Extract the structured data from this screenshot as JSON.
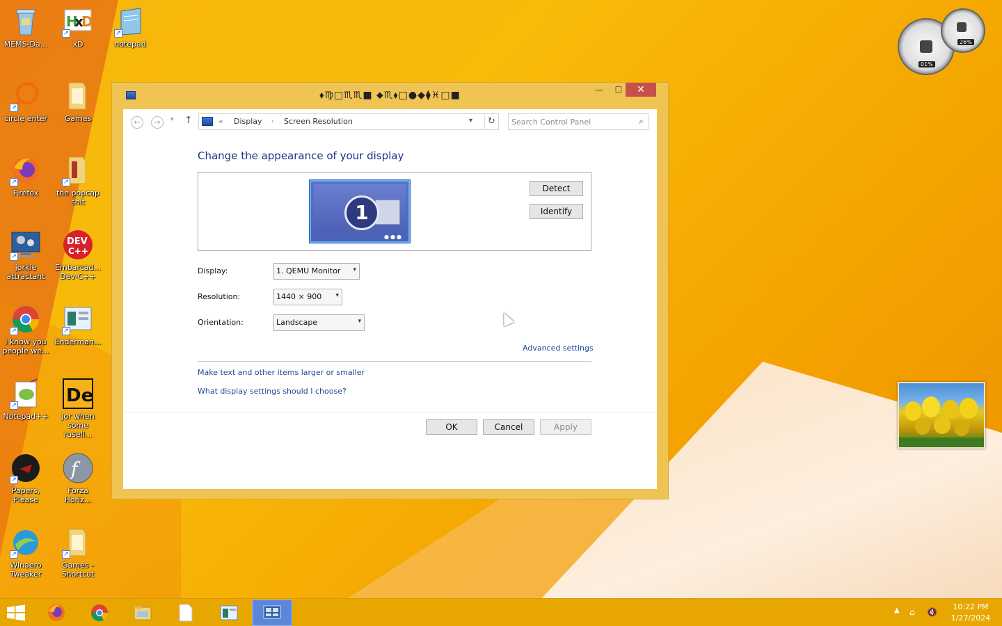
{
  "desktop": {
    "icons": [
      {
        "name": "recycle-bin",
        "label": "MEMS-Da...",
        "icon": "recycle-bin-icon"
      },
      {
        "name": "hxd",
        "label": "xD",
        "icon": "hxd-icon"
      },
      {
        "name": "notepad",
        "label": "notepad",
        "icon": "notepad-icon"
      },
      {
        "name": "circle-enter",
        "label": "circle enter",
        "icon": "magnifier-icon"
      },
      {
        "name": "games-folder",
        "label": "Games",
        "icon": "folder-icon"
      },
      {
        "name": "firefox",
        "label": "Firefox",
        "icon": "firefox-icon"
      },
      {
        "name": "the-popcap",
        "label": "the popcap shit",
        "icon": "folder-icon"
      },
      {
        "name": "jorkie-attractant",
        "label": "jorkie attractant",
        "icon": "monitor-gear-icon"
      },
      {
        "name": "embarcadero-dev",
        "label": "Embarcad... Dev-C++",
        "icon": "devcpp-icon"
      },
      {
        "name": "chrome",
        "label": "i know you people we...",
        "icon": "chrome-icon"
      },
      {
        "name": "enderman",
        "label": "Enderman...",
        "icon": "window-app-icon"
      },
      {
        "name": "notepadpp",
        "label": "Notepad++",
        "icon": "notepadpp-icon"
      },
      {
        "name": "de-app",
        "label": "jor when some rusell...",
        "icon": "de-icon"
      },
      {
        "name": "papers-please",
        "label": "Papers, Please",
        "icon": "papers-please-icon"
      },
      {
        "name": "forza",
        "label": "Forza Horiz...",
        "icon": "flash-icon"
      },
      {
        "name": "winaero",
        "label": "Winaero Tweaker",
        "icon": "winaero-icon"
      },
      {
        "name": "games-shortcut",
        "label": "Games - Shortcut",
        "icon": "folder-icon"
      }
    ]
  },
  "gadgets": {
    "cpu_meter": {
      "cpu": "01%",
      "memory": "26%"
    },
    "slideshow": {
      "label": "tulips photo"
    }
  },
  "window": {
    "title": "⬧♍︎□︎♏︎♏︎■︎ ⬥︎♏︎⬧︎□︎●︎◆︎⧫︎♓︎□︎■︎",
    "controls": {
      "minimize": "—",
      "maximize": "☐",
      "close": "✕"
    },
    "address": {
      "prefix": "«",
      "crumbs": [
        "Display",
        "Screen Resolution"
      ],
      "separator": "›"
    },
    "search": {
      "placeholder": "Search Control Panel"
    },
    "heading": "Change the appearance of your display",
    "monitor": {
      "number": "1"
    },
    "buttons": {
      "detect": "Detect",
      "identify": "Identify",
      "ok": "OK",
      "cancel": "Cancel",
      "apply": "Apply"
    },
    "fields": {
      "display_label": "Display:",
      "display_value": "1. QEMU Monitor",
      "resolution_label": "Resolution:",
      "resolution_value": "1440 × 900",
      "orientation_label": "Orientation:",
      "orientation_value": "Landscape"
    },
    "links": {
      "advanced": "Advanced settings",
      "larger": "Make text and other items larger or smaller",
      "which": "What display settings should I choose?"
    }
  },
  "taskbar": {
    "items": [
      {
        "name": "firefox",
        "icon": "firefox-icon",
        "active": false
      },
      {
        "name": "chrome",
        "icon": "chrome-icon",
        "active": false
      },
      {
        "name": "file-explorer",
        "icon": "folder-icon",
        "active": false
      },
      {
        "name": "blank-document",
        "icon": "document-icon",
        "active": false
      },
      {
        "name": "app-window",
        "icon": "window-app-icon",
        "active": false
      },
      {
        "name": "control-panel",
        "icon": "control-panel-icon",
        "active": true
      }
    ],
    "clock": {
      "time": "10:22 PM",
      "date": "1/27/2024"
    }
  },
  "colors": {
    "accent": "#1e3287",
    "link": "#1f4a96",
    "window_frame": "#f0c453",
    "taskbar": "#e7a700",
    "close_button": "#c7504a"
  }
}
